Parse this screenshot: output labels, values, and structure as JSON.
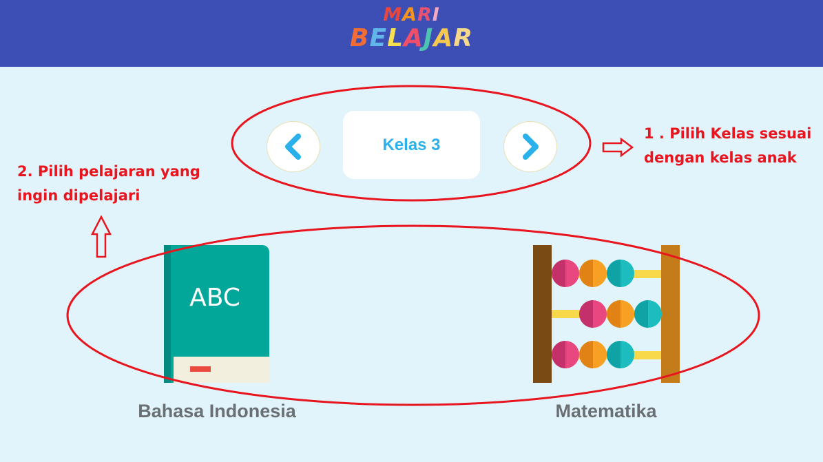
{
  "header": {
    "logo_line1": "MARI",
    "logo_line2": "BELAJAR",
    "logo_line1_colors": [
      "#e8473e",
      "#f7941d",
      "#e8536f",
      "#f6a8c2"
    ],
    "logo_line2_colors": [
      "#f26d36",
      "#62b5e8",
      "#f6e04f",
      "#f04f6a",
      "#4fc3b2",
      "#f6c84f",
      "#f6d98a"
    ],
    "background": "#3d4fb5"
  },
  "grade_selector": {
    "prev_icon": "chevron-left-icon",
    "next_icon": "chevron-right-icon",
    "current_grade": "Kelas 3",
    "accent": "#2ab0ea"
  },
  "annotations": {
    "step1": [
      "1 . Pilih Kelas sesuai",
      "dengan kelas anak"
    ],
    "step2": [
      "2. Pilih pelajaran yang",
      "ingin dipelajari"
    ],
    "color": "#e8141e"
  },
  "subjects": [
    {
      "label": "Bahasa Indonesia",
      "icon": "book-icon",
      "book_text": "ABC"
    },
    {
      "label": "Matematika",
      "icon": "abacus-icon"
    }
  ]
}
